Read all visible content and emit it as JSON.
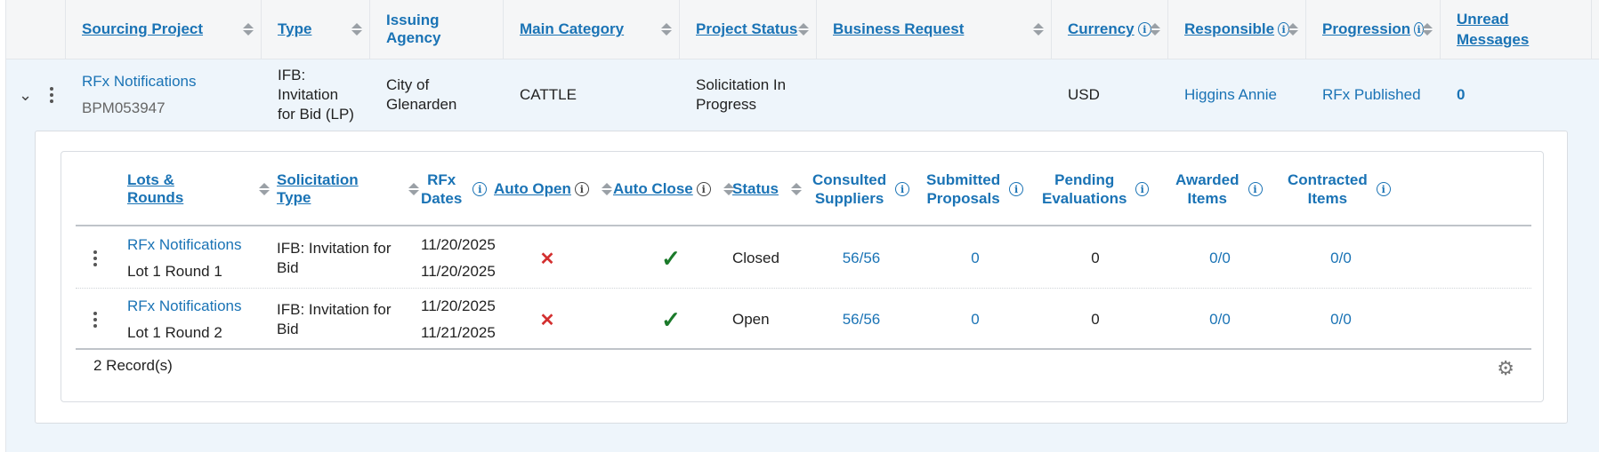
{
  "outer": {
    "headers": {
      "sourcing_project": "Sourcing Project",
      "type": "Type",
      "issuing_agency": "Issuing Agency",
      "main_category": "Main Category",
      "project_status": "Project Status",
      "business_request": "Business Request",
      "currency": "Currency",
      "responsible": "Responsible",
      "progression": "Progression",
      "unread_messages_1": "Unread",
      "unread_messages_2": "Messages"
    },
    "row": {
      "project_name": "RFx Notifications",
      "project_id": "BPM053947",
      "type_1": "IFB: Invitation",
      "type_2": "for Bid (LP)",
      "agency_1": "City of",
      "agency_2": "Glenarden",
      "main_category": "CATTLE",
      "status_1": "Solicitation In",
      "status_2": "Progress",
      "business_request": "",
      "currency": "USD",
      "responsible": "Higgins Annie",
      "progression": "RFx Published",
      "unread": "0"
    }
  },
  "inner": {
    "headers": {
      "lots_rounds": "Lots & Rounds",
      "solicitation_type": "Solicitation Type",
      "rfx_dates_1": "RFx",
      "rfx_dates_2": "Dates",
      "auto_open": "Auto Open",
      "auto_close": "Auto Close",
      "status": "Status",
      "consulted_1": "Consulted",
      "consulted_2": "Suppliers",
      "submitted_1": "Submitted",
      "submitted_2": "Proposals",
      "pending_1": "Pending",
      "pending_2": "Evaluations",
      "awarded_1": "Awarded",
      "awarded_2": "Items",
      "contracted_1": "Contracted",
      "contracted_2": "Items"
    },
    "rows": [
      {
        "name": "RFx Notifications",
        "lot": "Lot 1 Round 1",
        "sol_1": "IFB: Invitation for",
        "sol_2": "Bid",
        "date_start": "11/20/2025",
        "date_end": "11/20/2025",
        "auto_open": "✕",
        "auto_close": "✓",
        "status": "Closed",
        "consulted": "56/56",
        "submitted": "0",
        "pending": "0",
        "awarded": "0/0",
        "contracted": "0/0"
      },
      {
        "name": "RFx Notifications",
        "lot": "Lot 1 Round 2",
        "sol_1": "IFB: Invitation for",
        "sol_2": "Bid",
        "date_start": "11/20/2025",
        "date_end": "11/21/2025",
        "auto_open": "✕",
        "auto_close": "✓",
        "status": "Open",
        "consulted": "56/56",
        "submitted": "0",
        "pending": "0",
        "awarded": "0/0",
        "contracted": "0/0"
      }
    ],
    "records": "2 Record(s)"
  },
  "icons": {
    "info": "i",
    "gear": "⚙",
    "chevron": "⌄"
  },
  "colors": {
    "link": "#1a73b5",
    "row_bg": "#eef5fb",
    "cross": "#d32f2f",
    "check": "#1b7a2a"
  }
}
